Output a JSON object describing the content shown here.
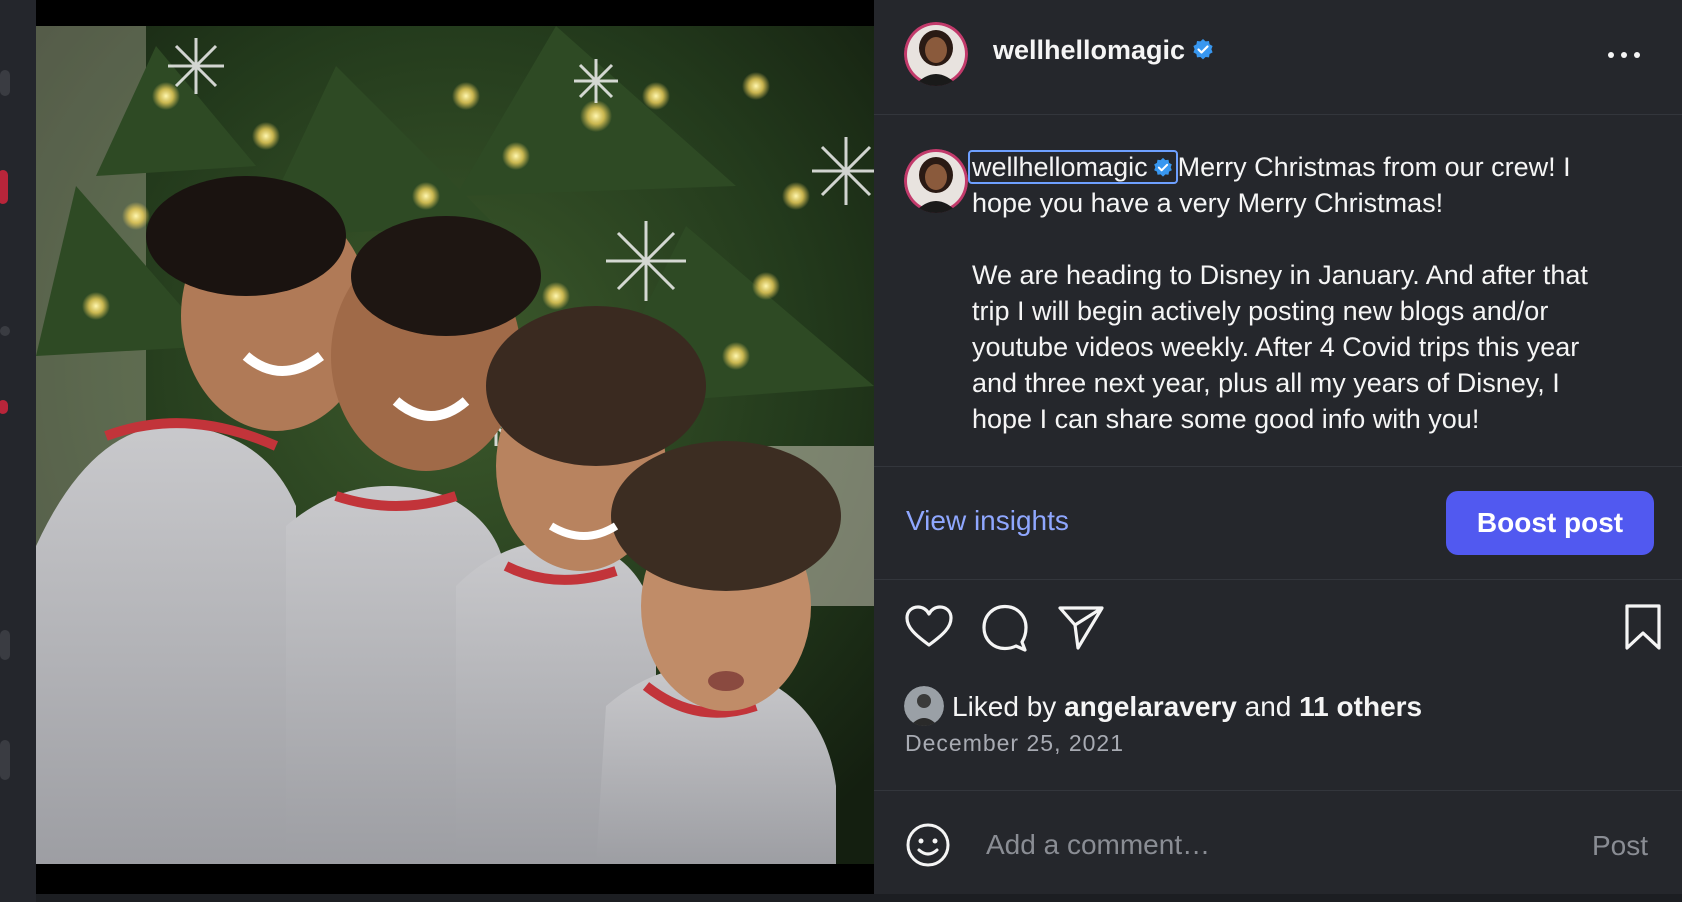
{
  "post": {
    "username": "wellhellomagic",
    "verified": true,
    "caption": "Merry Christmas from our crew! I hope you have a very Merry Christmas!\n\nWe are heading to Disney in January. And after that trip I will begin actively posting new blogs and/or youtube videos weekly. After 4 Covid trips this year and three next year, plus all my years of Disney, I hope I can share some good info with you!",
    "view_insights_label": "View insights",
    "boost_label": "Boost post",
    "liked_by_prefix": "Liked by",
    "liked_by_user": "angelaravery",
    "liked_by_and": "and",
    "liked_by_others": "11 others",
    "date": "December 25, 2021",
    "comment_placeholder": "Add a comment…",
    "post_button_label": "Post"
  },
  "colors": {
    "accent": "#5159f0",
    "link": "#8fa7ff",
    "verified": "#3897f0",
    "panel_bg": "#25272c"
  },
  "icons": [
    "more-options-icon",
    "verified-badge-icon",
    "heart-icon",
    "comment-icon",
    "share-icon",
    "bookmark-icon",
    "emoji-icon"
  ]
}
